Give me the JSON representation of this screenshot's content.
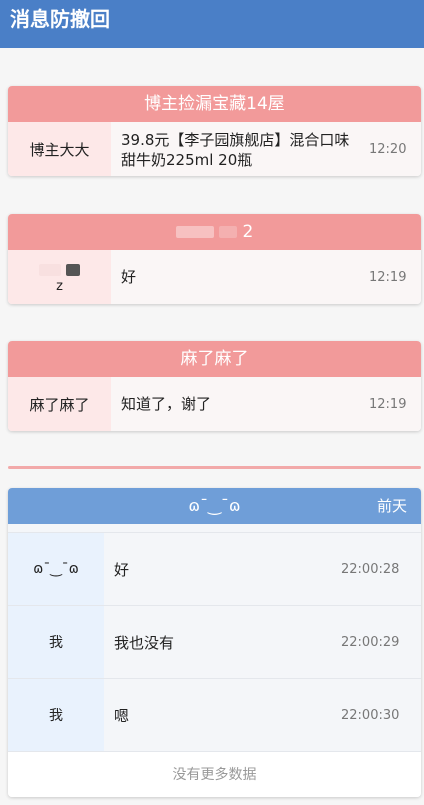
{
  "app": {
    "title": "消息防撤回"
  },
  "cards": [
    {
      "header": "博主捡漏宝藏14屋",
      "sender": "博主大大",
      "message": "39.8元【李子园旗舰店】混合口味甜牛奶225ml 20瓶",
      "time": "12:20"
    },
    {
      "header": "2",
      "sender": "z",
      "message": "好",
      "time": "12:19"
    },
    {
      "header": "麻了麻了",
      "sender": "麻了麻了",
      "message": "知道了，谢了",
      "time": "12:19"
    }
  ],
  "blue_card": {
    "header": "ɷ¯‿¯ɷ",
    "date": "前天",
    "rows": [
      {
        "sender": "ɷ¯‿¯ɷ",
        "message": "好",
        "time": "22:00:28"
      },
      {
        "sender": "我",
        "message": "我也没有",
        "time": "22:00:29"
      },
      {
        "sender": "我",
        "message": "嗯",
        "time": "22:00:30"
      }
    ],
    "footer": "没有更多数据"
  }
}
